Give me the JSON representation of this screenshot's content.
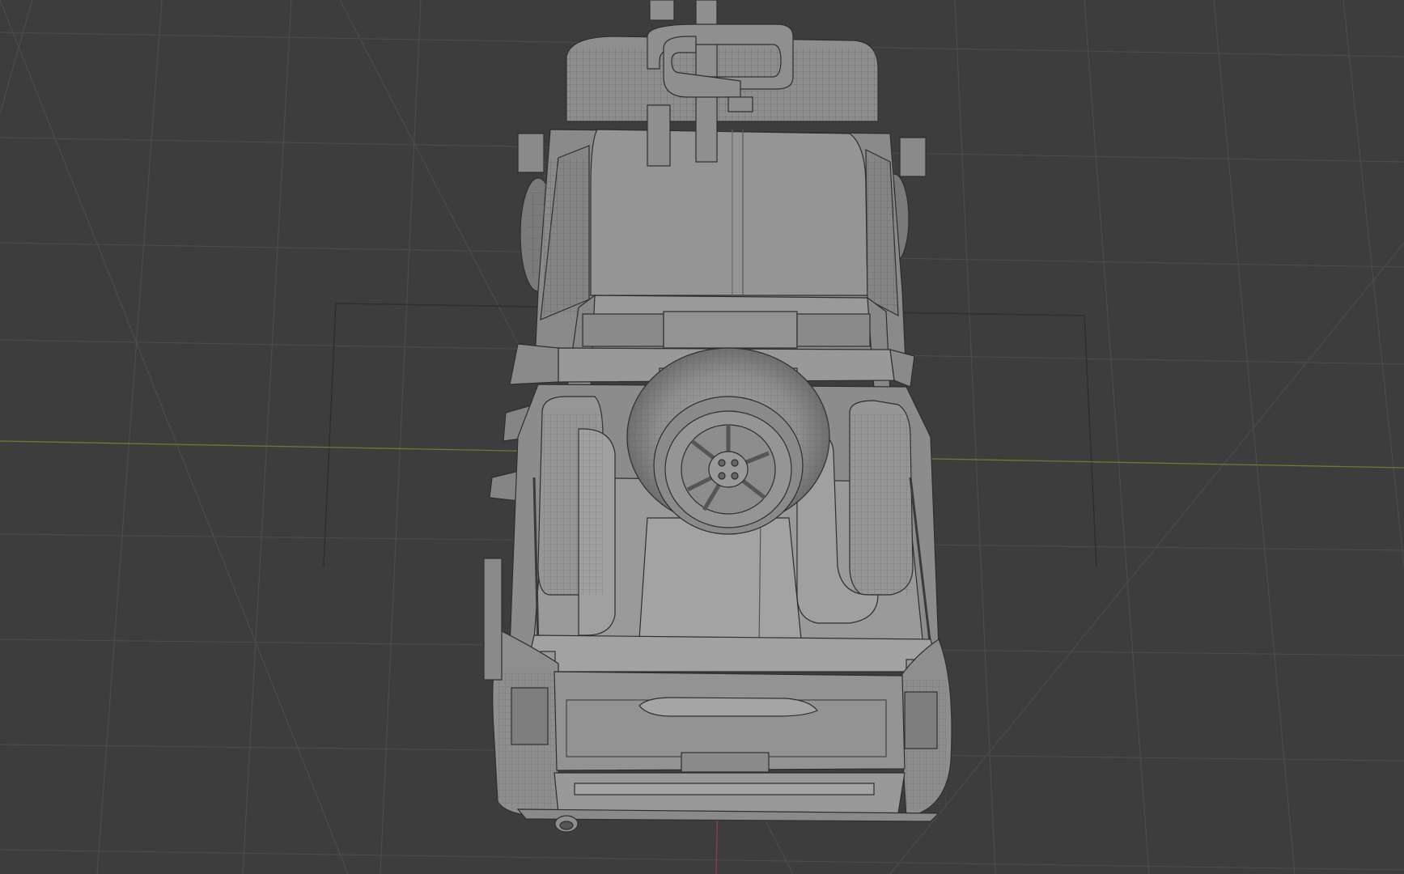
{
  "viewport": {
    "background": "#3d3d3d",
    "grid_color": "#4a4a4a",
    "horizon_axis_color": "#7a8a3a",
    "vertical_axis_color": "#9a3a4a",
    "mesh_fill": "#8c8c8c",
    "mesh_light": "#9e9e9e",
    "mesh_dark": "#6a6a6a",
    "wire_color": "#2e2e2e",
    "object": "truck-mesh-wireframe"
  }
}
